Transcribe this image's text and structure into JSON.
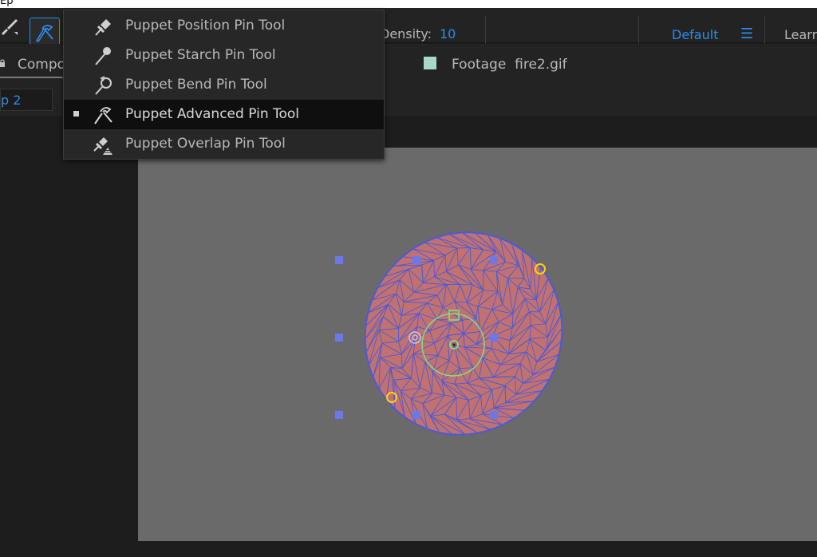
{
  "top_strip": {
    "text": "Ep"
  },
  "toolbar": {
    "density_label": "Density:",
    "density_value": "10",
    "workspace_default": "Default",
    "workspace_learn": "Learn"
  },
  "panel": {
    "composition_tab_label": "Compo",
    "footage_tab_label": "Footage  fire2.gif",
    "comp_name_tab": "p 2"
  },
  "puppet_menu": {
    "items": [
      {
        "label": "Puppet Position Pin Tool",
        "icon": "pin-icon",
        "selected": false
      },
      {
        "label": "Puppet Starch Pin Tool",
        "icon": "starch-pin-icon",
        "selected": false
      },
      {
        "label": "Puppet Bend Pin Tool",
        "icon": "bend-pin-icon",
        "selected": false
      },
      {
        "label": "Puppet Advanced Pin Tool",
        "icon": "advanced-pin-icon",
        "selected": true
      },
      {
        "label": "Puppet Overlap Pin Tool",
        "icon": "overlap-pin-icon",
        "selected": false
      }
    ]
  },
  "colors": {
    "accent": "#2d8ceb",
    "mesh_fill": "#c27171",
    "mesh_lines": "#4a5bd6",
    "pin_yellow": "#ffd400",
    "pin_green": "#7fe07f",
    "handle": "#6b79e8",
    "comp_bg": "#6a6a6a"
  }
}
